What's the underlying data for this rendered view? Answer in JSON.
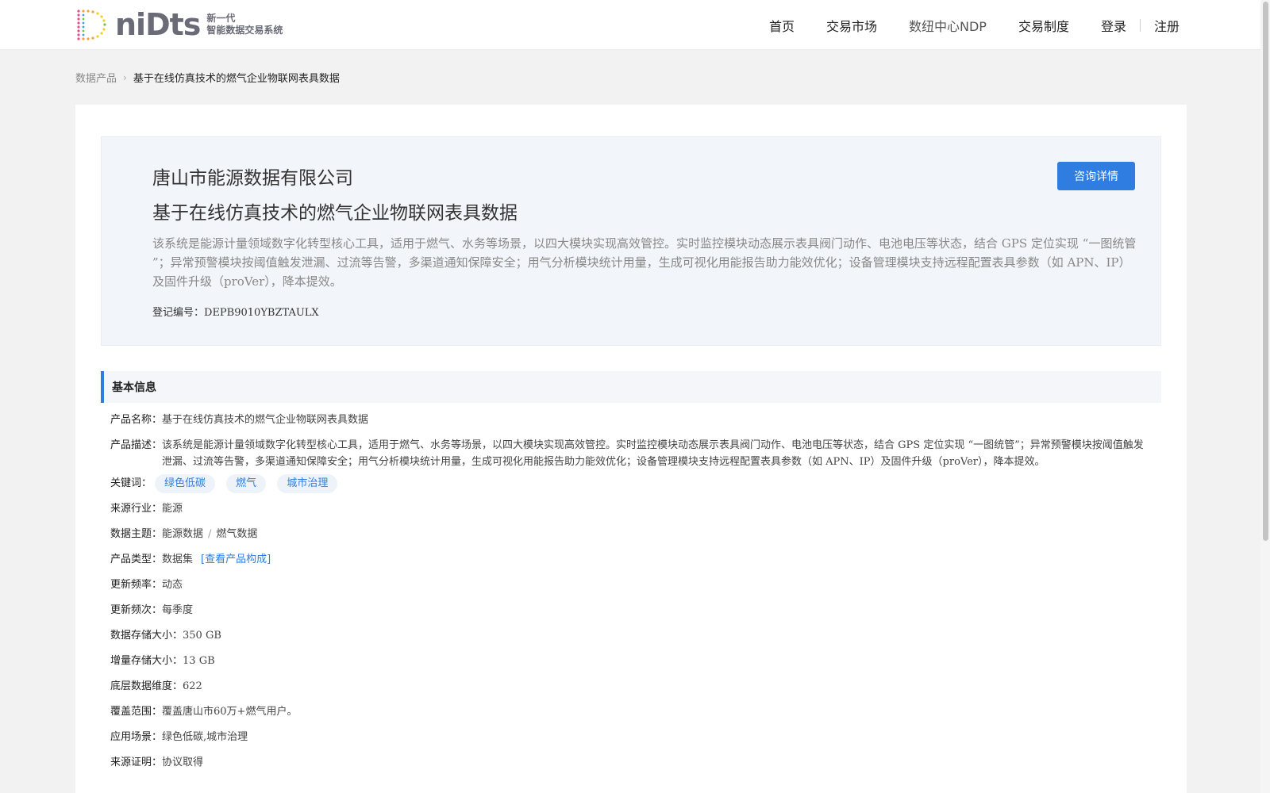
{
  "header": {
    "logo": {
      "word": "niDts",
      "tag_line1": "新一代",
      "tag_line2": "智能数据交易系统"
    },
    "nav": [
      {
        "label": "首页"
      },
      {
        "label": "交易市场"
      },
      {
        "label": "数纽中心NDP"
      },
      {
        "label": "交易制度"
      }
    ],
    "login": "登录",
    "register": "注册"
  },
  "breadcrumb": {
    "parent": "数据产品",
    "current": "基于在线仿真技术的燃气企业物联网表具数据"
  },
  "hero": {
    "company": "唐山市能源数据有限公司",
    "title": "基于在线仿真技术的燃气企业物联网表具数据",
    "consult_button": "咨询详情",
    "description": "该系统是能源计量领域数字化转型核心工具，适用于燃气、水务等场景，以四大模块实现高效管控。实时监控模块动态展示表具阀门动作、电池电压等状态，结合 GPS 定位实现 “一图统管 ”；异常预警模块按阈值触发泄漏、过流等告警，多渠道通知保障安全；用气分析模块统计用量，生成可视化用能报告助力能效优化；设备管理模块支持远程配置表具参数（如 APN、IP）及固件升级（proVer），降本提效。",
    "reg_label": "登记编号：",
    "reg_value": "DEPB9010YBZTAULX"
  },
  "basic_info": {
    "title": "基本信息",
    "product_name_label": "产品名称：",
    "product_name": "基于在线仿真技术的燃气企业物联网表具数据",
    "desc_label": "产品描述：",
    "desc": "该系统是能源计量领域数字化转型核心工具，适用于燃气、水务等场景，以四大模块实现高效管控。实时监控模块动态展示表具阀门动作、电池电压等状态，结合 GPS 定位实现 “一图统管”；异常预警模块按阈值触发泄漏、过流等告警，多渠道通知保障安全；用气分析模块统计用量，生成可视化用能报告助力能效优化；设备管理模块支持远程配置表具参数（如 APN、IP）及固件升级（proVer），降本提效。",
    "keywords_label": "关键词：",
    "keywords": [
      "绿色低碳",
      "燃气",
      "城市治理"
    ],
    "industry_label": "来源行业：",
    "industry": "能源",
    "theme_label": "数据主题：",
    "theme_main": "能源数据",
    "theme_sep": "/",
    "theme_sub": "燃气数据",
    "type_label": "产品类型：",
    "type": "数据集",
    "type_link": "[查看产品构成]",
    "freq_label": "更新频率：",
    "freq": "动态",
    "times_label": "更新频次：",
    "times": "每季度",
    "storage_label": "数据存储大小：",
    "storage": "350 GB",
    "incr_label": "增量存储大小：",
    "incr": "13 GB",
    "dim_label": "底层数据维度：",
    "dim": "622",
    "coverage_label": "覆盖范围：",
    "coverage": "覆盖唐山市60万+燃气用户。",
    "scene_label": "应用场景：",
    "scene": "绿色低碳,城市治理",
    "proof_label": "来源证明：",
    "proof": "协议取得"
  },
  "colors": {
    "accent": "#2f7de1",
    "page_bg": "#f2f2f2",
    "hero_bg": "#f2f5f9"
  }
}
